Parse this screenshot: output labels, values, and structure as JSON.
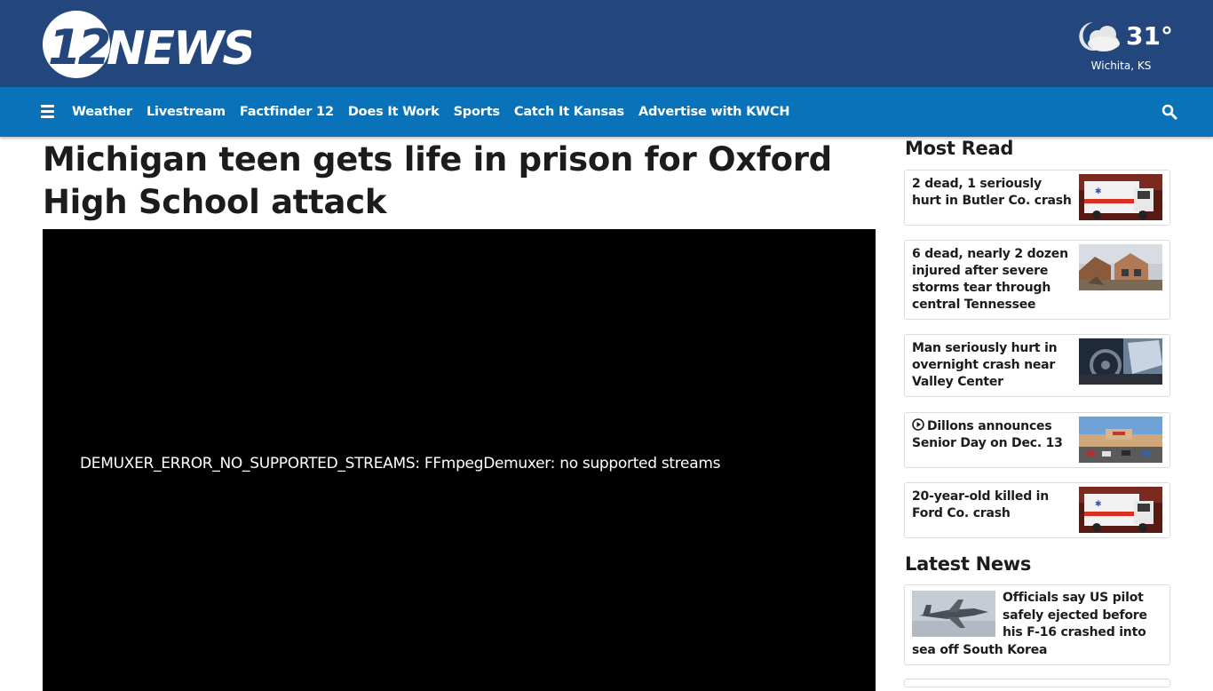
{
  "brand": {
    "name": "12 NEWS",
    "number": "12",
    "word": "NEWS"
  },
  "weather": {
    "temperature": "31°",
    "location": "Wichita, KS",
    "icon": "partly-cloudy-night-icon"
  },
  "nav": {
    "menu_icon": "hamburger-icon",
    "links": [
      "Weather",
      "Livestream",
      "Factfinder 12",
      "Does It Work",
      "Sports",
      "Catch It Kansas",
      "Advertise with KWCH"
    ],
    "search_icon": "search-icon"
  },
  "article": {
    "title": "Michigan teen gets life in prison for Oxford High School attack",
    "player_error": "DEMUXER_ERROR_NO_SUPPORTED_STREAMS: FFmpegDemuxer: no supported streams"
  },
  "most_read": {
    "title": "Most Read",
    "items": [
      {
        "headline": "2 dead, 1 seriously hurt in Butler Co. crash",
        "thumb": "ambulance-photo"
      },
      {
        "headline": "6 dead, nearly 2 dozen injured after severe storms tear through central Tennessee",
        "thumb": "storm-damage-photo"
      },
      {
        "headline": "Man seriously hurt in overnight crash near Valley Center",
        "thumb": "crashed-car-interior-photo"
      },
      {
        "headline": "Dillons announces Senior Day on Dec. 13",
        "thumb": "store-parking-lot-photo",
        "video": true
      },
      {
        "headline": "20-year-old killed in Ford Co. crash",
        "thumb": "ambulance-photo"
      }
    ]
  },
  "latest_news": {
    "title": "Latest News",
    "items": [
      {
        "headline": "Officials say US pilot safely ejected before his F-16 crashed into sea off South Korea",
        "thumb": "fighter-jet-photo"
      }
    ]
  },
  "colors": {
    "header_bg": "#23467c",
    "nav_bg": "#0a72b8",
    "player_bg": "#000000",
    "text": "#1c1c1c"
  }
}
